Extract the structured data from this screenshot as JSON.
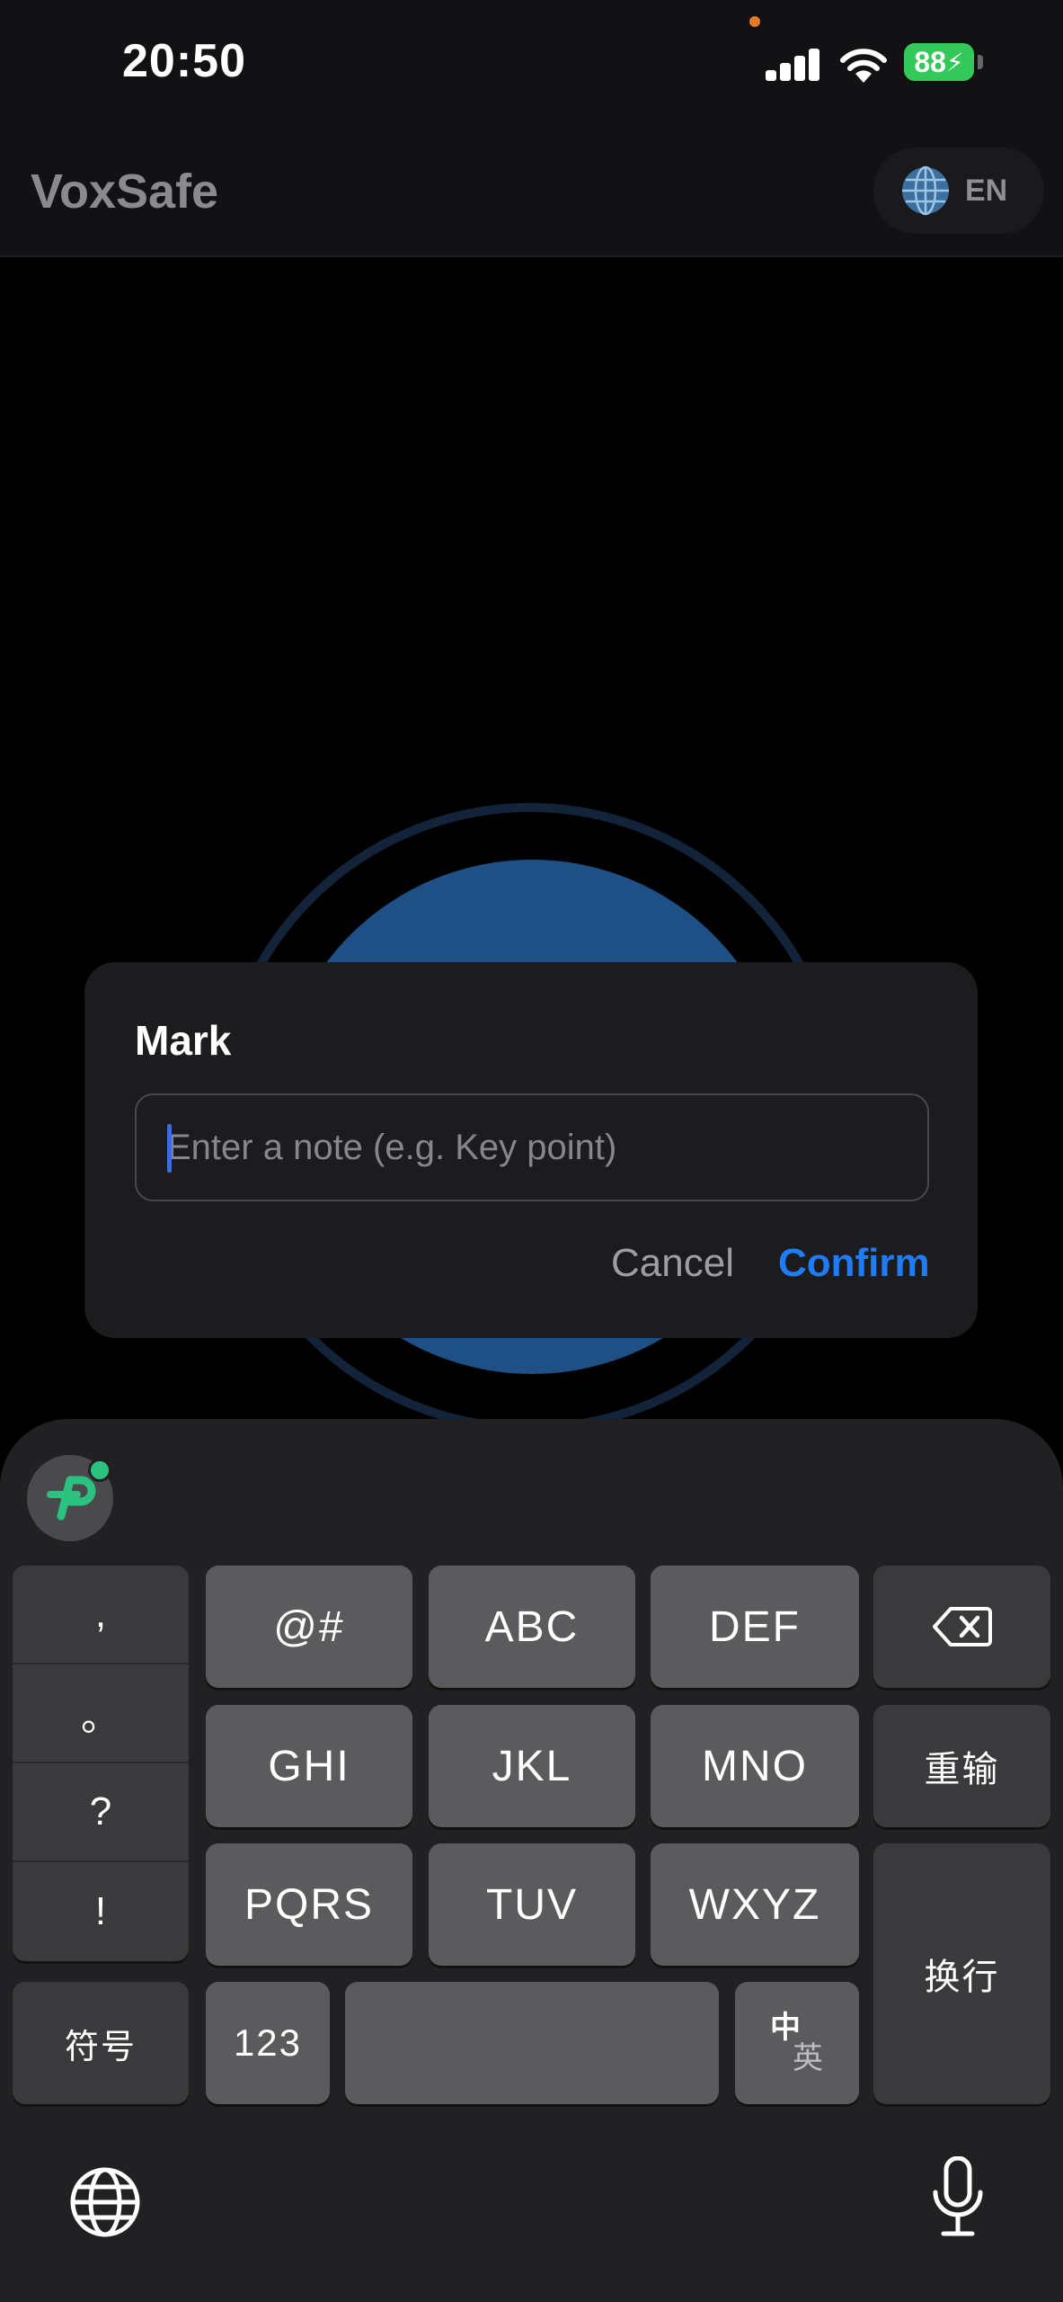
{
  "status_bar": {
    "time": "20:50",
    "battery": "88",
    "battery_color": "#34c759",
    "privacy_dot_color": "#e07b2a"
  },
  "header": {
    "title": "VoxSafe",
    "language_label": "EN",
    "language_icon": "globe-emoji-icon"
  },
  "dialog": {
    "title": "Mark",
    "input_value": "",
    "input_placeholder": "Enter a note (e.g. Key point)",
    "cancel_label": "Cancel",
    "confirm_label": "Confirm",
    "accent_color": "#1f7cf5"
  },
  "keyboard": {
    "punctuation": [
      ",",
      "。",
      "?",
      "!"
    ],
    "row1": [
      "@#",
      "ABC",
      "DEF"
    ],
    "row2": [
      "GHI",
      "JKL",
      "MNO"
    ],
    "row3": [
      "PQRS",
      "TUV",
      "WXYZ"
    ],
    "retype_label": "重输",
    "newline_label": "换行",
    "symbols_label": "符号",
    "numbers_label": "123",
    "space_label": "",
    "lang_switch_top": "中",
    "lang_switch_bottom": "英",
    "backspace_icon": "backspace-icon",
    "globe_icon": "globe-icon",
    "mic_icon": "microphone-icon"
  }
}
